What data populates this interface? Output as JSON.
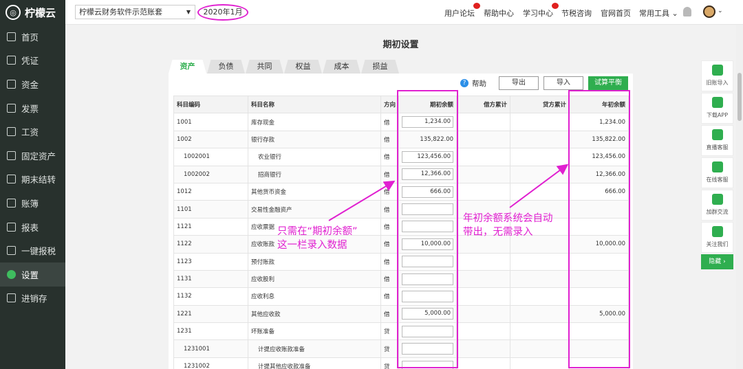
{
  "app": {
    "name": "柠檬云"
  },
  "sidebar": {
    "items": [
      {
        "label": "首页",
        "icon": "home-icon"
      },
      {
        "label": "凭证",
        "icon": "voucher-icon"
      },
      {
        "label": "资金",
        "icon": "fund-icon"
      },
      {
        "label": "发票",
        "icon": "invoice-icon"
      },
      {
        "label": "工资",
        "icon": "salary-icon"
      },
      {
        "label": "固定资产",
        "icon": "fixed-asset-icon"
      },
      {
        "label": "期末结转",
        "icon": "period-end-icon"
      },
      {
        "label": "账簿",
        "icon": "ledger-icon"
      },
      {
        "label": "报表",
        "icon": "report-icon"
      },
      {
        "label": "一键报税",
        "icon": "tax-icon"
      },
      {
        "label": "设置",
        "icon": "settings-icon",
        "active": true
      },
      {
        "label": "进销存",
        "icon": "inventory-icon"
      }
    ]
  },
  "header": {
    "account_set": "柠檬云财务软件示范账套",
    "period": "2020年1月",
    "links": [
      "用户论坛",
      "帮助中心",
      "学习中心",
      "节税咨询",
      "官网首页",
      "常用工具"
    ]
  },
  "page": {
    "title": "期初设置"
  },
  "tabs": [
    "资产",
    "负债",
    "共同",
    "权益",
    "成本",
    "损益"
  ],
  "toolbar": {
    "help": "帮助",
    "export": "导出",
    "import": "导入",
    "trial": "试算平衡"
  },
  "table": {
    "headers": [
      "科目编码",
      "科目名称",
      "方向",
      "期初余额",
      "借方累计",
      "贷方累计",
      "年初余额"
    ],
    "rows": [
      {
        "code": "1001",
        "name": "库存现金",
        "dir": "借",
        "opening": "1,234.00",
        "year": "1,234.00"
      },
      {
        "code": "1002",
        "name": "银行存款",
        "dir": "借",
        "opening": "135,822.00",
        "year": "135,822.00"
      },
      {
        "code": "1002001",
        "name": "农业银行",
        "dir": "借",
        "opening": "123,456.00",
        "year": "123,456.00"
      },
      {
        "code": "1002002",
        "name": "招商银行",
        "dir": "借",
        "opening": "12,366.00",
        "year": "12,366.00"
      },
      {
        "code": "1012",
        "name": "其他货币资金",
        "dir": "借",
        "opening": "666.00",
        "year": "666.00"
      },
      {
        "code": "1101",
        "name": "交易性金融资产",
        "dir": "借",
        "opening": "",
        "year": ""
      },
      {
        "code": "1121",
        "name": "应收票据",
        "dir": "借",
        "opening": "",
        "year": ""
      },
      {
        "code": "1122",
        "name": "应收账款",
        "dir": "借",
        "opening": "10,000.00",
        "year": "10,000.00"
      },
      {
        "code": "1123",
        "name": "预付账款",
        "dir": "借",
        "opening": "",
        "year": ""
      },
      {
        "code": "1131",
        "name": "应收股利",
        "dir": "借",
        "opening": "",
        "year": ""
      },
      {
        "code": "1132",
        "name": "应收利息",
        "dir": "借",
        "opening": "",
        "year": ""
      },
      {
        "code": "1221",
        "name": "其他应收款",
        "dir": "借",
        "opening": "5,000.00",
        "year": "5,000.00"
      },
      {
        "code": "1231",
        "name": "坏账准备",
        "dir": "贷",
        "opening": "",
        "year": ""
      },
      {
        "code": "1231001",
        "name": "计提应收账款准备",
        "dir": "贷",
        "opening": "",
        "year": ""
      },
      {
        "code": "1231002",
        "name": "计提其他应收款准备",
        "dir": "贷",
        "opening": "",
        "year": ""
      }
    ]
  },
  "annotations": {
    "left_line1": "只需在“期初余额”",
    "left_line2": "这一栏录入数据",
    "right_line1": "年初余额系统会自动",
    "right_line2": "带出，无需录入"
  },
  "right_panel": {
    "items": [
      "旧账导入",
      "下载APP",
      "直播客服",
      "在线客服",
      "加群交流",
      "关注我们"
    ],
    "hide": "隐藏 ›"
  },
  "colors": {
    "sidebar_bg": "#28312d",
    "accent_green": "#2fae4f",
    "annotation_magenta": "#e020d0"
  }
}
